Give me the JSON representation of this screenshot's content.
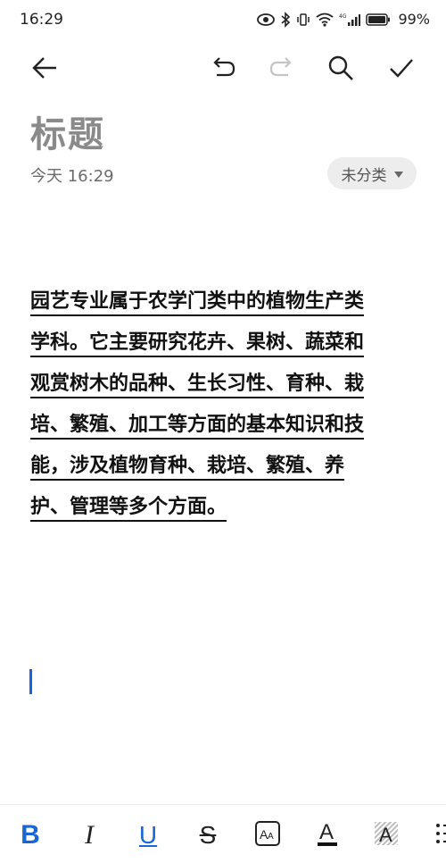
{
  "status_bar": {
    "time": "16:29",
    "network_label": "4G",
    "battery_percent": "99%"
  },
  "toolbar": {
    "back_icon": "arrow-left-icon",
    "undo_icon": "undo-icon",
    "redo_icon": "redo-icon",
    "search_icon": "search-icon",
    "done_icon": "check-icon"
  },
  "note": {
    "title": "标题",
    "date": "今天 16:29",
    "category": "未分类",
    "body_lines": [
      "园艺专业属于农学门类中的植物生产类",
      "学科。它主要研究花卉、果树、蔬菜和",
      "观赏树木的品种、生长习性、育种、栽",
      "培、繁殖、加工等方面的基本知识和技",
      "能，涉及植物育种、栽培、繁殖、养",
      "护、管理等多个方面。"
    ]
  },
  "format_bar": {
    "bold": "B",
    "italic": "I",
    "underline": "U",
    "strikethrough": "S",
    "font_size": "AA",
    "font_color": "A",
    "highlight": "A"
  },
  "colors": {
    "accent": "#1a66d2",
    "title_gray": "#8a8a8a",
    "chip_bg": "#ededed"
  }
}
